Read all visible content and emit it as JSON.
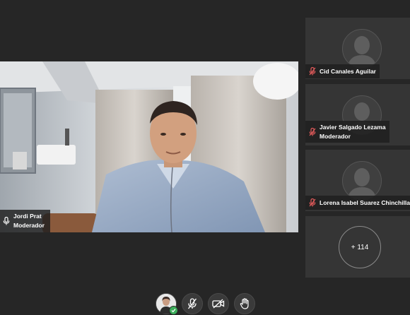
{
  "main_speaker": {
    "name": "Jordi Prat",
    "role": "Moderador"
  },
  "participants": [
    {
      "name": "Cid Canales Aguilar",
      "role": "",
      "mic": "muted"
    },
    {
      "name": "Javier Salgado Lezama",
      "role": "Moderador",
      "mic": "muted"
    },
    {
      "name": "Lorena Isabel Suarez Chinchilla",
      "role": "",
      "mic": "muted"
    }
  ],
  "more_participants": "+ 114",
  "toolbar": {
    "buttons": [
      "self-avatar",
      "mic-muted-icon",
      "camera-off-icon",
      "raise-hand-icon"
    ],
    "status": "connected"
  },
  "colors": {
    "background": "#262626",
    "tile": "#353535",
    "status_green": "#3cae5b"
  }
}
